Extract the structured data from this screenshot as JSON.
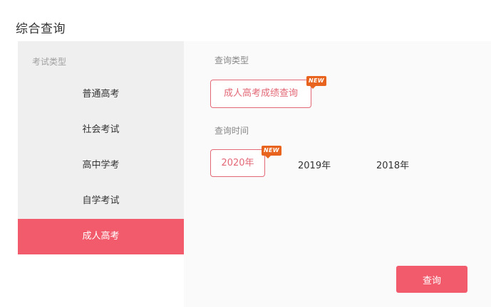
{
  "page_title": "综合查询",
  "sidebar": {
    "header": "考试类型",
    "items": [
      {
        "label": "普通高考",
        "active": false
      },
      {
        "label": "社会考试",
        "active": false
      },
      {
        "label": "高中学考",
        "active": false
      },
      {
        "label": "自学考试",
        "active": false
      },
      {
        "label": "成人高考",
        "active": true
      }
    ]
  },
  "query_type": {
    "label": "查询类型",
    "option": "成人高考成绩查询",
    "badge": "NEW"
  },
  "query_time": {
    "label": "查询时间",
    "years": [
      {
        "label": "2020年",
        "selected": true,
        "badge": "NEW"
      },
      {
        "label": "2019年",
        "selected": false
      },
      {
        "label": "2018年",
        "selected": false
      }
    ]
  },
  "query_button": "查询",
  "colors": {
    "accent": "#f15b6c",
    "badge": "#e8641e",
    "sidebar_bg": "#efefef"
  }
}
